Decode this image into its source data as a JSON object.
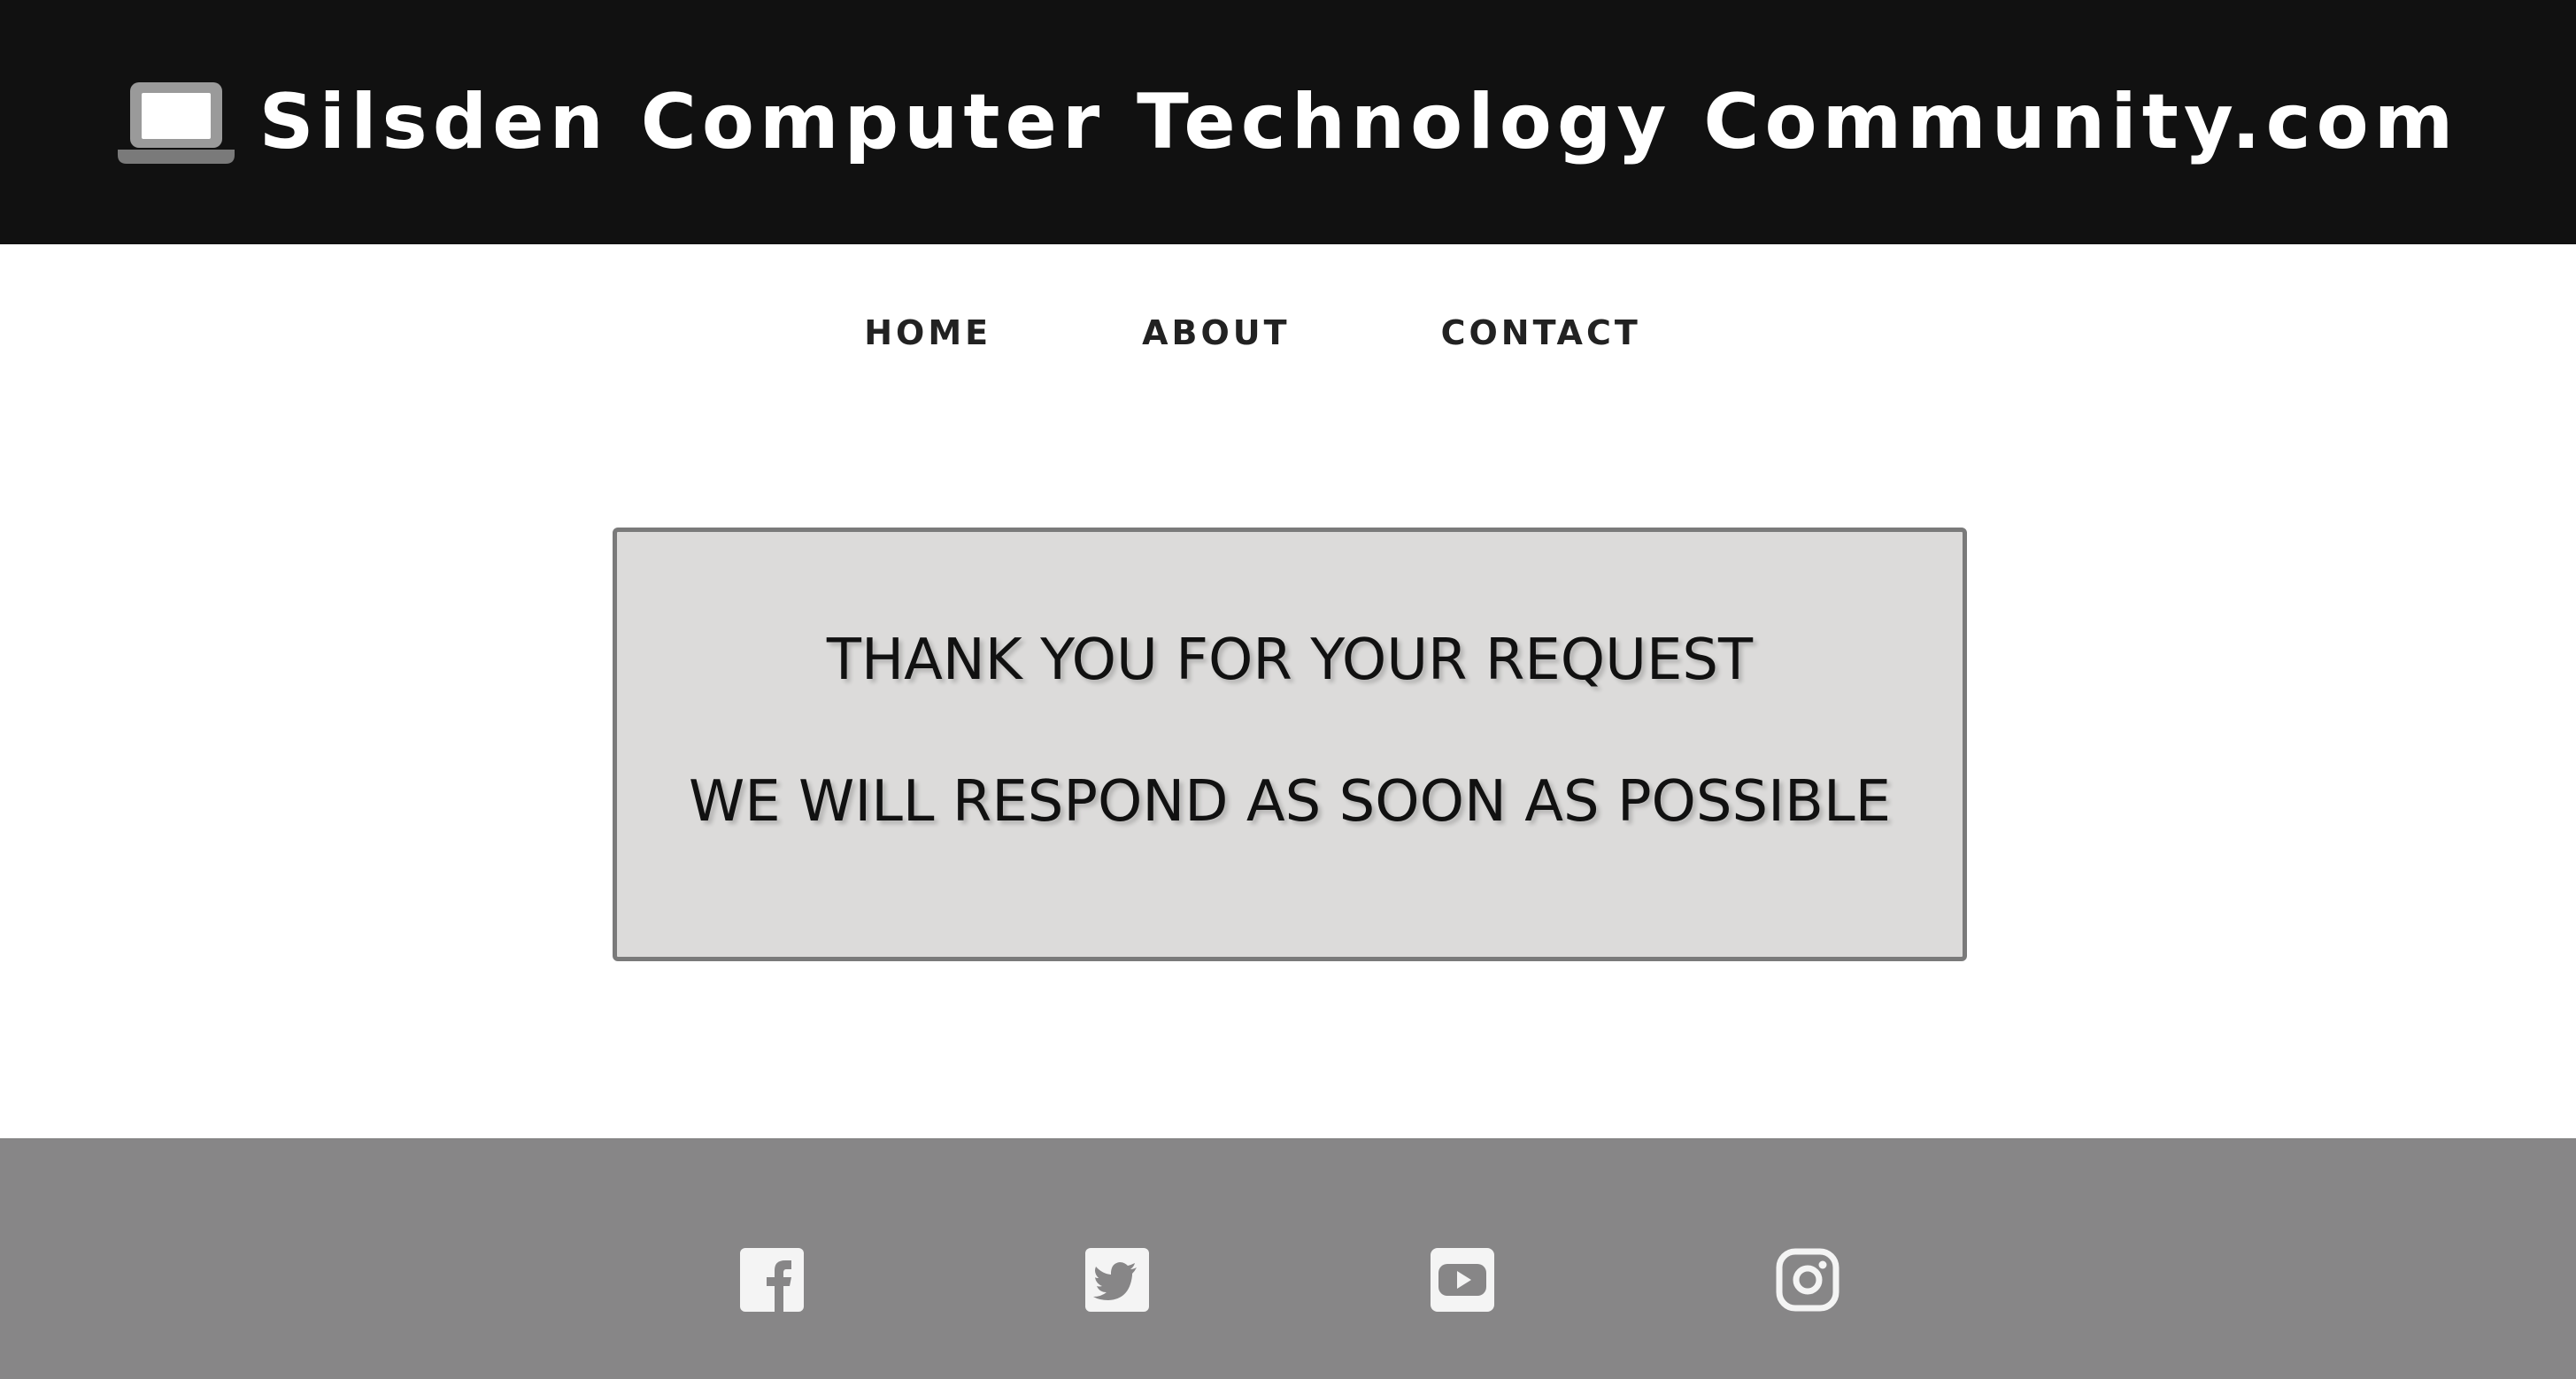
{
  "header": {
    "title": "Silsden Computer Technology Community.com",
    "logo_icon": "laptop-icon"
  },
  "nav": {
    "items": [
      {
        "label": "HOME"
      },
      {
        "label": "ABOUT"
      },
      {
        "label": "CONTACT"
      }
    ]
  },
  "message": {
    "line1": "THANK YOU FOR YOUR REQUEST",
    "line2": "WE WILL RESPOND AS SOON AS POSSIBLE"
  },
  "footer": {
    "social_icons": [
      "facebook-icon",
      "twitter-icon",
      "youtube-icon",
      "instagram-icon"
    ]
  },
  "colors": {
    "header_bg": "#111111",
    "footer_bg": "#878687",
    "message_bg": "#dcdbda",
    "message_border": "#7a7a7a",
    "icon_fill": "#f4f4f4"
  }
}
